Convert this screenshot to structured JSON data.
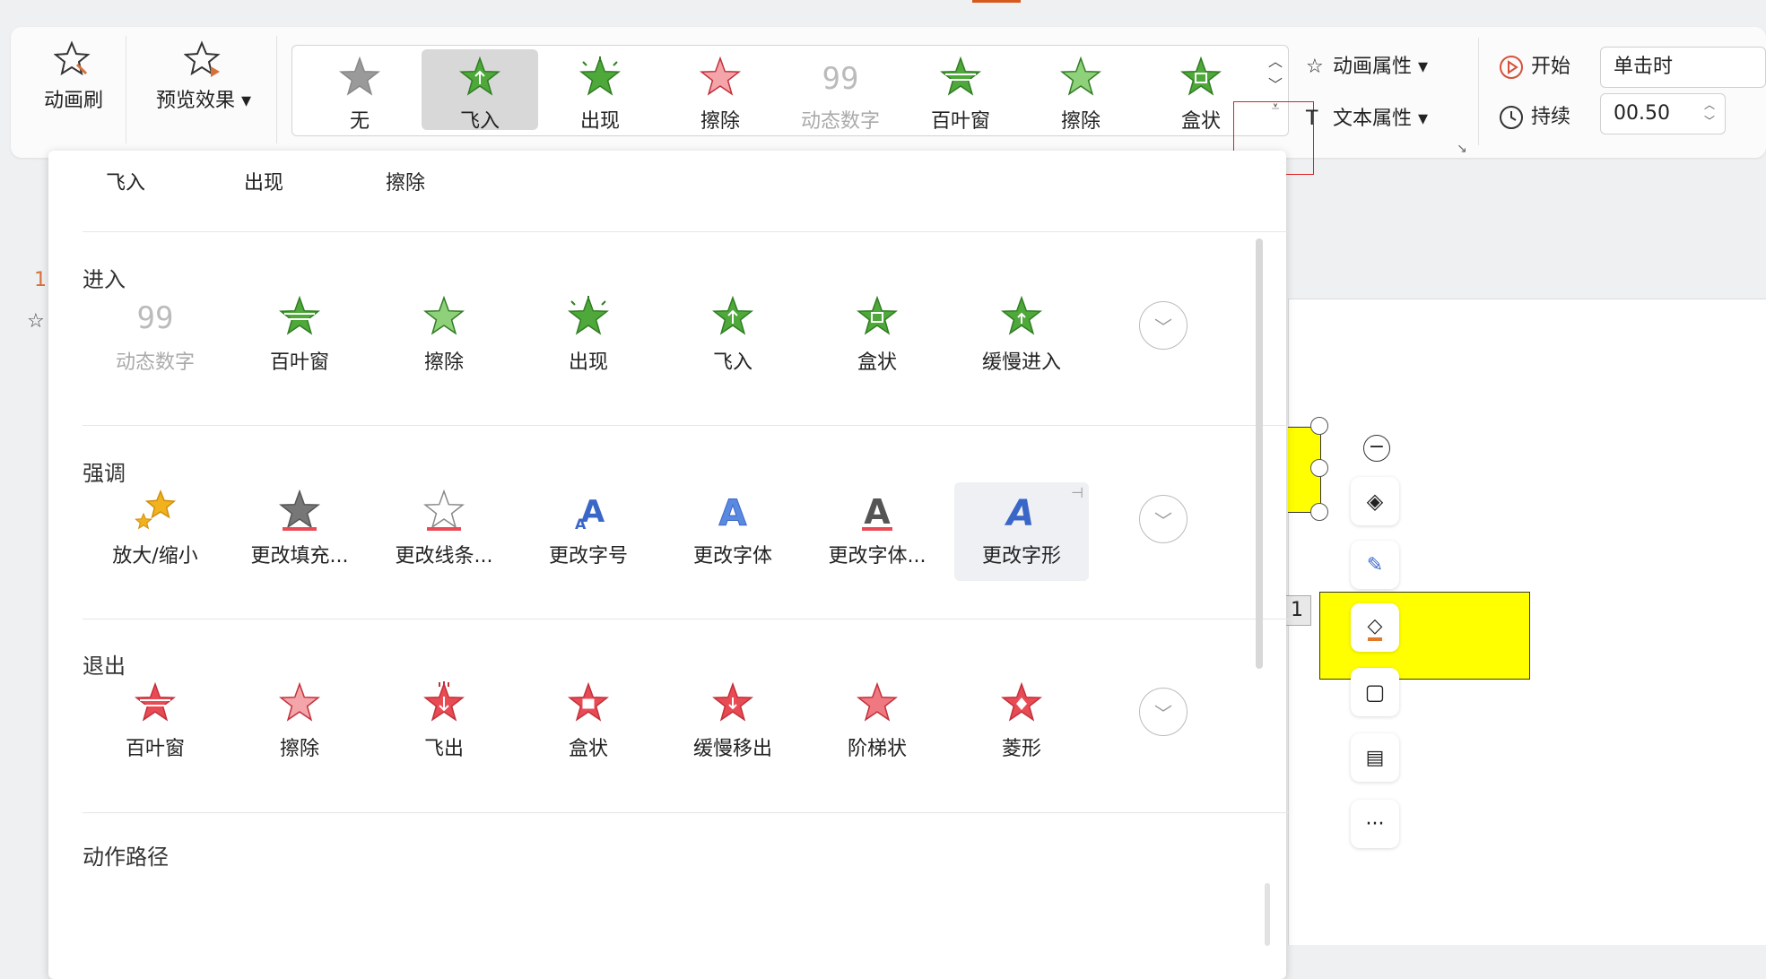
{
  "colors": {
    "accent": "#d65a1e",
    "green_star": "#3f9a2e",
    "red_star": "#e0414a",
    "highlight": "#e02020",
    "yellow": "#ffff00"
  },
  "ribbon": {
    "anim_brush": "动画刷",
    "preview": "预览效果 ▾",
    "gallery": [
      {
        "label": "无",
        "icon": "gray-star-icon",
        "selected": false
      },
      {
        "label": "飞入",
        "icon": "fly-in-star-icon",
        "selected": true
      },
      {
        "label": "出现",
        "icon": "appear-star-icon",
        "selected": false
      },
      {
        "label": "擦除",
        "icon": "wipe-red-star-icon",
        "selected": false
      },
      {
        "label": "动态数字",
        "icon": "dynamic-number-icon",
        "selected": false
      },
      {
        "label": "百叶窗",
        "icon": "blinds-star-icon",
        "selected": false
      },
      {
        "label": "擦除",
        "icon": "wipe-star-icon",
        "selected": false
      },
      {
        "label": "盒状",
        "icon": "box-star-icon",
        "selected": false
      }
    ],
    "anim_props": "动画属性 ▾",
    "text_props": "文本属性 ▾",
    "start_label": "开始",
    "start_value": "单击时",
    "duration_label": "持续",
    "duration_value": "00.50"
  },
  "left": {
    "slide_num": "1"
  },
  "canvas": {
    "badge": "1"
  },
  "panel": {
    "recent": [
      "飞入",
      "出现",
      "擦除"
    ],
    "sections": [
      {
        "title": "进入",
        "items": [
          {
            "label": "动态数字",
            "icon": "dynamic-number-icon"
          },
          {
            "label": "百叶窗",
            "icon": "blinds-star-icon"
          },
          {
            "label": "擦除",
            "icon": "wipe-star-icon"
          },
          {
            "label": "出现",
            "icon": "appear-star-icon"
          },
          {
            "label": "飞入",
            "icon": "fly-in-star-icon"
          },
          {
            "label": "盒状",
            "icon": "box-star-icon"
          },
          {
            "label": "缓慢进入",
            "icon": "slow-in-star-icon"
          }
        ]
      },
      {
        "title": "强调",
        "items": [
          {
            "label": "放大/缩小",
            "icon": "grow-shrink-icon"
          },
          {
            "label": "更改填充...",
            "icon": "change-fill-icon"
          },
          {
            "label": "更改线条...",
            "icon": "change-line-icon"
          },
          {
            "label": "更改字号",
            "icon": "change-font-size-icon"
          },
          {
            "label": "更改字体",
            "icon": "change-font-icon"
          },
          {
            "label": "更改字体...",
            "icon": "change-font-color-icon"
          },
          {
            "label": "更改字形",
            "icon": "change-font-style-icon"
          }
        ]
      },
      {
        "title": "退出",
        "items": [
          {
            "label": "百叶窗",
            "icon": "exit-blinds-icon"
          },
          {
            "label": "擦除",
            "icon": "exit-wipe-icon"
          },
          {
            "label": "飞出",
            "icon": "fly-out-icon"
          },
          {
            "label": "盒状",
            "icon": "exit-box-icon"
          },
          {
            "label": "缓慢移出",
            "icon": "slow-out-icon"
          },
          {
            "label": "阶梯状",
            "icon": "stairs-icon"
          },
          {
            "label": "菱形",
            "icon": "diamond-icon"
          }
        ]
      }
    ],
    "motion_path_title": "动作路径"
  }
}
